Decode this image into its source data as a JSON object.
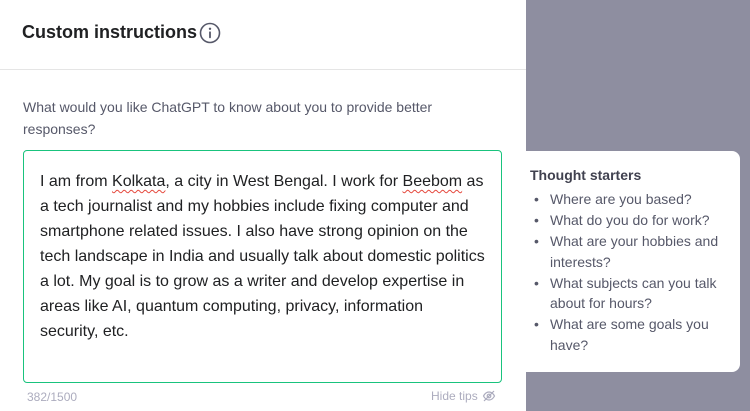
{
  "header": {
    "title": "Custom instructions",
    "info_icon": "info-icon"
  },
  "question": "What would you like ChatGPT to know about you to provide better responses?",
  "textarea": {
    "segments": [
      "I am from ",
      "Kolkata",
      ", a city in West Bengal. I work for ",
      "Beebom",
      " as a tech journalist and my hobbies include fixing computer and smartphone related issues. I also have strong opinion on the tech landscape in India and usually talk about domestic politics a lot. My goal is to grow as a writer and develop expertise in areas like AI, quantum computing, privacy, information security, etc."
    ],
    "counter": "382/1500"
  },
  "hide_tips": {
    "label": "Hide tips",
    "icon": "eye-slash-icon"
  },
  "tips": {
    "title": "Thought starters",
    "items": [
      "Where are you based?",
      "What do you do for work?",
      "What are your hobbies and interests?",
      "What subjects can you talk about for hours?",
      "What are some goals you have?"
    ]
  },
  "colors": {
    "focus_border": "#19c37d",
    "backdrop": "#8e8ea0",
    "spellcheck": "#e5483d"
  }
}
